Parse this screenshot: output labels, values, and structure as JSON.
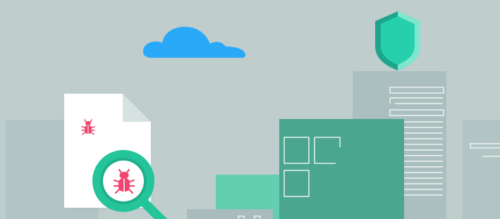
{
  "colors": {
    "background": "#bfcecd",
    "cloud": "#29a9f8",
    "shield_dark": "#1fa98f",
    "shield_light": "#26d0ad",
    "shield_rim": "#7fe6cf",
    "building_gray": "#aec1c0",
    "building_gray_dark": "#a3b7b6",
    "building_green_dark": "#4aa68e",
    "building_green_light": "#63cfae",
    "document": "#ffffff",
    "document_fold": "#d8e3e2",
    "bug": "#f0456f",
    "magnifier_ring": "#25c49b",
    "magnifier_inner": "#ffffff",
    "line_white": "#ffffff"
  },
  "icons": {
    "cloud": "cloud-icon",
    "shield": "shield-icon",
    "document": "document-icon",
    "bug_small": "bug-icon",
    "magnifier": "magnifier-icon",
    "bug_large": "bug-icon"
  }
}
